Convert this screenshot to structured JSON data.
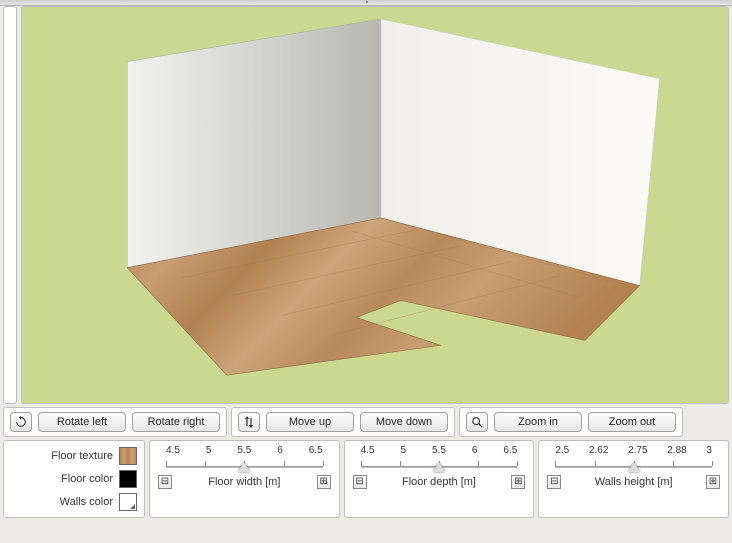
{
  "toolbar": {
    "rotate_left": "Rotate left",
    "rotate_right": "Rotate right",
    "move_up": "Move up",
    "move_down": "Move down",
    "zoom_in": "Zoom in",
    "zoom_out": "Zoom out"
  },
  "swatches": {
    "floor_texture_label": "Floor texture",
    "floor_color_label": "Floor color",
    "walls_color_label": "Walls color",
    "floor_texture_value": "wood-light",
    "floor_color_value": "#000000",
    "walls_color_value": "#ffffff"
  },
  "sliders": {
    "floor_width": {
      "caption": "Floor width [m]",
      "ticks": [
        "4.5",
        "5",
        "5.5",
        "6",
        "6.5"
      ],
      "min": 4.5,
      "max": 6.5,
      "value": 5.5
    },
    "floor_depth": {
      "caption": "Floor depth [m]",
      "ticks": [
        "4.5",
        "5",
        "5.5",
        "6",
        "6.5"
      ],
      "min": 4.5,
      "max": 6.5,
      "value": 5.5
    },
    "walls_height": {
      "caption": "Walls height [m]",
      "ticks": [
        "2.5",
        "2.62",
        "2.75",
        "2.88",
        "3"
      ],
      "min": 2.5,
      "max": 3.0,
      "value": 2.75
    }
  },
  "icons": {
    "rotate": "rotate-icon",
    "move_vert": "move-vertical-icon",
    "zoom": "magnifier-icon",
    "minus": "⊟",
    "plus": "⊞"
  },
  "colors": {
    "background": "#cad890",
    "panel": "#ffffff"
  }
}
